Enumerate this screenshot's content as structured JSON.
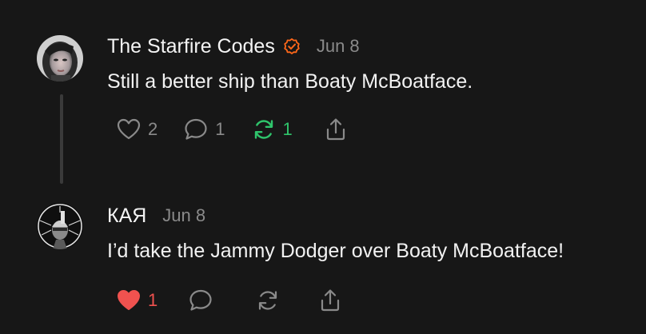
{
  "posts": [
    {
      "author": "The Starfire Codes",
      "verified": true,
      "date": "Jun 8",
      "text": "Still a better ship than Boaty McBoatface.",
      "likes": "2",
      "comments": "1",
      "restacks": "1",
      "liked": false,
      "restacked": true
    },
    {
      "author": "КАЯ",
      "verified": false,
      "date": "Jun 8",
      "text": "I’d take the Jammy Dodger over Boaty McBoatface!",
      "likes": "1",
      "liked": true
    }
  ],
  "colors": {
    "background": "#171717",
    "verified_badge": "#ff6719",
    "restack_active": "#2fc46b",
    "like_active": "#f0524f",
    "muted": "#8a8a8a"
  },
  "icons": [
    "heart-icon",
    "comment-icon",
    "restack-icon",
    "share-icon",
    "verified-badge-icon"
  ]
}
